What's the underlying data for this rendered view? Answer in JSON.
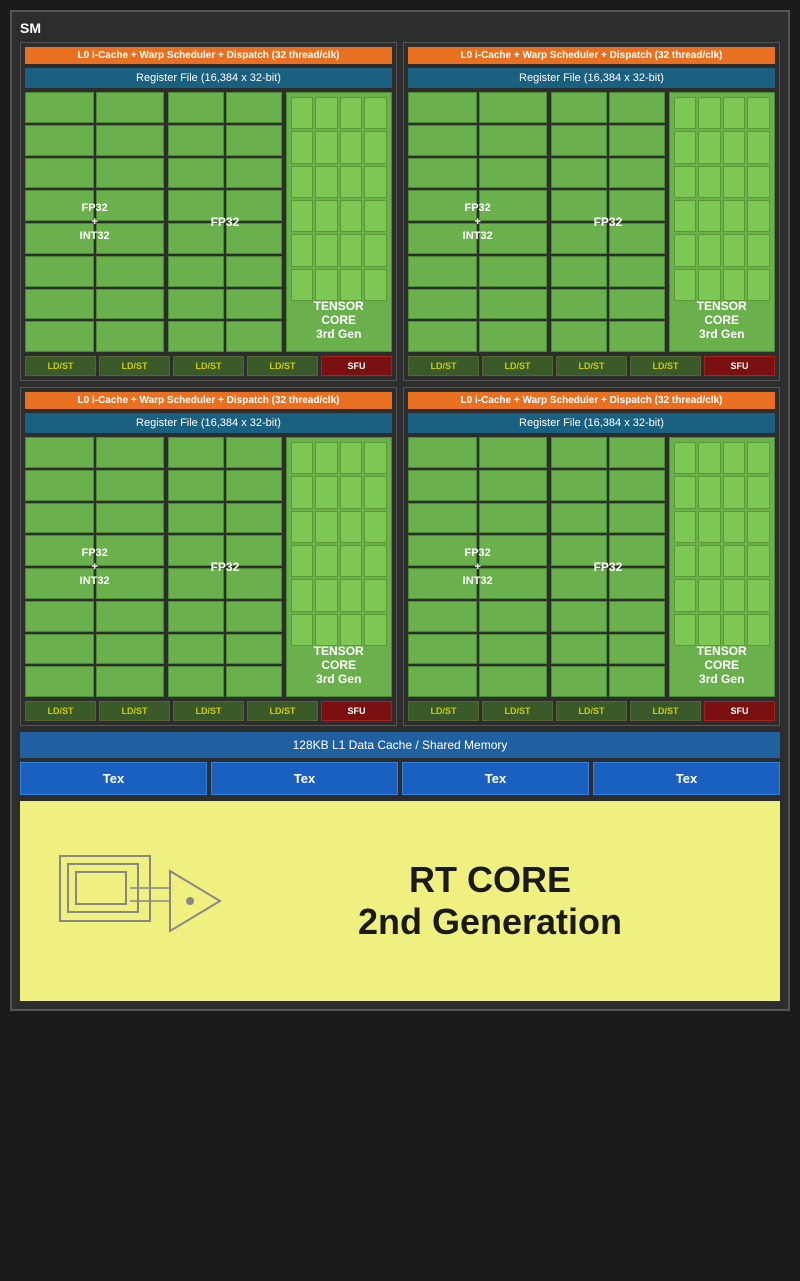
{
  "sm": {
    "label": "SM",
    "quadrants": [
      {
        "id": "q1",
        "warp_label": "L0 i-Cache + Warp Scheduler + Dispatch (32 thread/clk)",
        "register_label": "Register File (16,384 x 32-bit)",
        "fp32_int32_label": "FP32\n+\nINT32",
        "fp32_label": "FP32",
        "tensor_label": "TENSOR\nCORE\n3rd Gen",
        "units": [
          "LD/ST",
          "LD/ST",
          "LD/ST",
          "LD/ST"
        ],
        "sfu": "SFU"
      },
      {
        "id": "q2",
        "warp_label": "L0 i-Cache + Warp Scheduler + Dispatch (32 thread/clk)",
        "register_label": "Register File (16,384 x 32-bit)",
        "fp32_int32_label": "FP32\n+\nINT32",
        "fp32_label": "FP32",
        "tensor_label": "TENSOR\nCORE\n3rd Gen",
        "units": [
          "LD/ST",
          "LD/ST",
          "LD/ST",
          "LD/ST"
        ],
        "sfu": "SFU"
      },
      {
        "id": "q3",
        "warp_label": "L0 i-Cache + Warp Scheduler + Dispatch (32 thread/clk)",
        "register_label": "Register File (16,384 x 32-bit)",
        "fp32_int32_label": "FP32\n+\nINT32",
        "fp32_label": "FP32",
        "tensor_label": "TENSOR\nCORE\n3rd Gen",
        "units": [
          "LD/ST",
          "LD/ST",
          "LD/ST",
          "LD/ST"
        ],
        "sfu": "SFU"
      },
      {
        "id": "q4",
        "warp_label": "L0 i-Cache + Warp Scheduler + Dispatch (32 thread/clk)",
        "register_label": "Register File (16,384 x 32-bit)",
        "fp32_int32_label": "FP32\n+\nINT32",
        "fp32_label": "FP32",
        "tensor_label": "TENSOR\nCORE\n3rd Gen",
        "units": [
          "LD/ST",
          "LD/ST",
          "LD/ST",
          "LD/ST"
        ],
        "sfu": "SFU"
      }
    ],
    "l1_cache_label": "128KB L1 Data Cache / Shared Memory",
    "tex_units": [
      "Tex",
      "Tex",
      "Tex",
      "Tex"
    ],
    "rt_core_line1": "RT CORE",
    "rt_core_line2": "2nd Generation"
  }
}
